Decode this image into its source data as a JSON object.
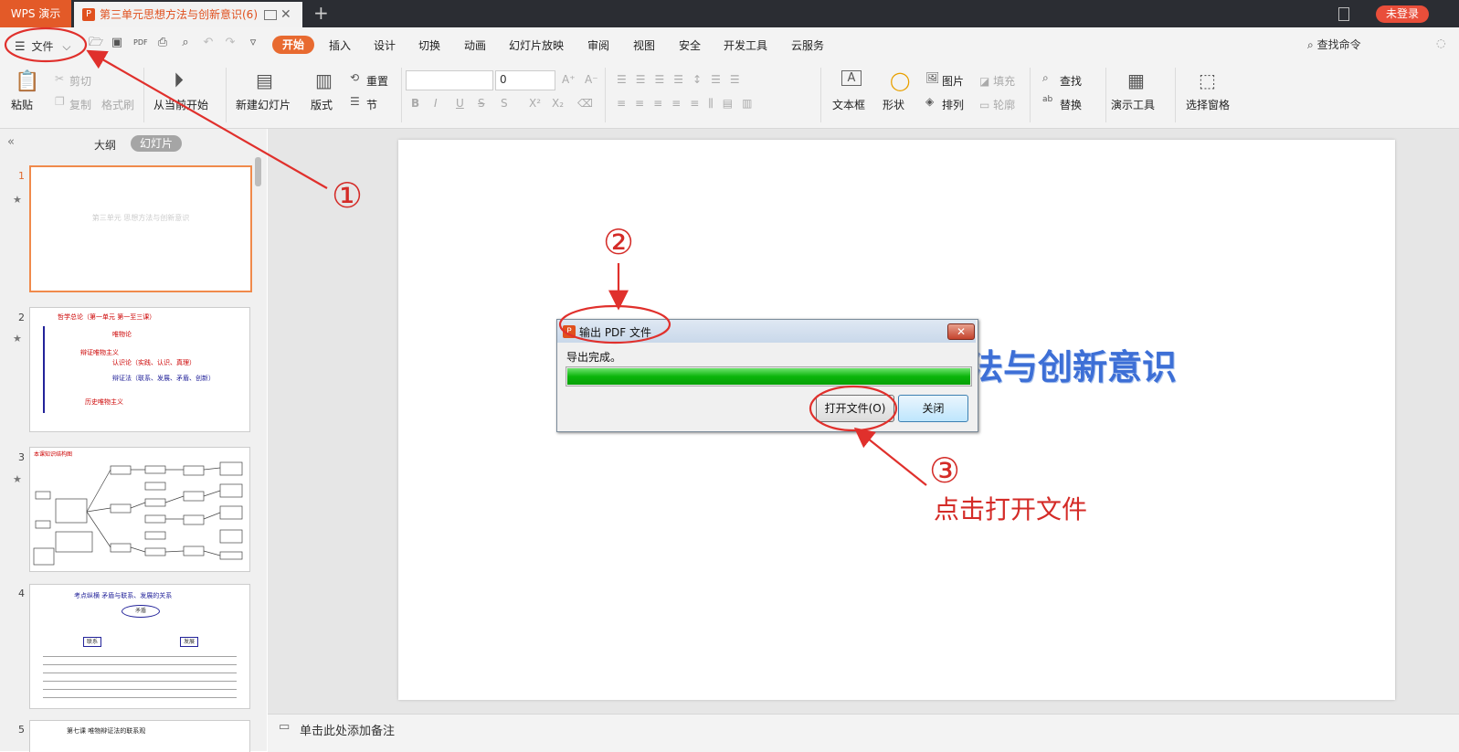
{
  "titlebar": {
    "app_tab": "WPS 演示",
    "doc_tab": "第三单元思想方法与创新意识(6)",
    "doc_tab_close": "✕",
    "new_tab": "+",
    "login_button": "未登录"
  },
  "menubar": {
    "file_menu": "文件",
    "items": [
      "开始",
      "插入",
      "设计",
      "切换",
      "动画",
      "幻灯片放映",
      "审阅",
      "视图",
      "安全",
      "开发工具",
      "云服务"
    ],
    "search_command": "查找命令"
  },
  "ribbon": {
    "paste": "粘贴",
    "cut": "剪切",
    "copy": "复制",
    "format_painter": "格式刷",
    "from_current": "从当前开始",
    "new_slide": "新建幻灯片",
    "layout": "版式",
    "reset": "重置",
    "section": "节",
    "font_size_value": "0",
    "text_box": "文本框",
    "shape": "形状",
    "picture": "图片",
    "arrange": "排列",
    "fill": "填充",
    "outline": "轮廓",
    "find": "查找",
    "replace": "替换",
    "present_tools": "演示工具",
    "selection_pane": "选择窗格"
  },
  "sidepanel": {
    "tab_outline": "大纲",
    "tab_slides": "幻灯片",
    "collapse": "«",
    "slides": [
      {
        "num": "1",
        "star": "★",
        "caption": "第三单元 思想方法与创新意识"
      },
      {
        "num": "2",
        "star": "★",
        "caption": "哲学总论（第一单元 第一至三课）",
        "lines": [
          "唯物论",
          "辩证唯物主义",
          "认识论（实践、认识、真理）",
          "辩证法（联系、发展、矛盾、创新）",
          "历史唯物主义"
        ]
      },
      {
        "num": "3",
        "star": "★",
        "caption": "本课知识结构图"
      },
      {
        "num": "4",
        "star": "",
        "caption": "考点纵横   矛盾与联系、发展的关系",
        "labels": [
          "矛盾",
          "联系",
          "发展"
        ]
      },
      {
        "num": "5",
        "star": "",
        "caption": "第七课  唯物辩证法的联系观"
      }
    ]
  },
  "slide": {
    "title_visible": "法与创新意识"
  },
  "notes": {
    "placeholder": "单击此处添加备注"
  },
  "dialog": {
    "title": "输出 PDF 文件",
    "close": "✕",
    "message": "导出完成。",
    "progress": 1.0,
    "open_button": "打开文件(O)",
    "close_button": "关闭"
  },
  "annotations": {
    "step1": "①",
    "step2": "②",
    "step3": "③",
    "step3_text": "点击打开文件",
    "color": "#e0302c"
  }
}
